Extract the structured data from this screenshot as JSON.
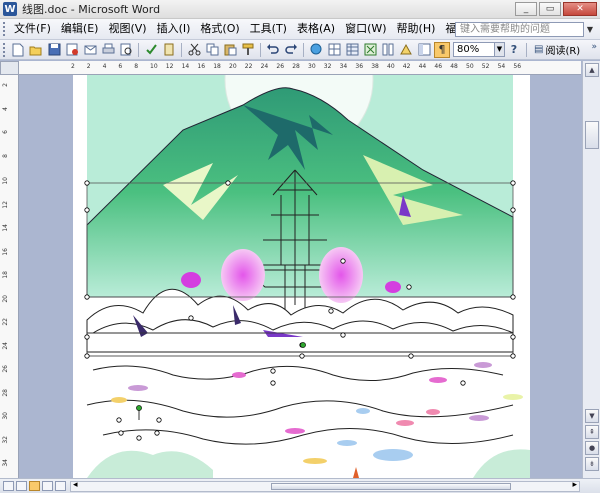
{
  "window": {
    "title": "线图.doc - Microsoft Word",
    "app_icon": "W",
    "minimize": "_",
    "restore": "▭",
    "close": "✕"
  },
  "menubar": {
    "items": [
      "文件(F)",
      "编辑(E)",
      "视图(V)",
      "插入(I)",
      "格式(O)",
      "工具(T)",
      "表格(A)",
      "窗口(W)",
      "帮助(H)",
      "福昕阅读器"
    ],
    "help_placeholder": "键入需要帮助的问题",
    "dropdown_glyph": "▼"
  },
  "toolbar": {
    "icons": [
      "new-document-icon",
      "open-folder-icon",
      "save-icon",
      "permission-icon",
      "email-icon",
      "print-icon",
      "print-preview-icon",
      "spelling-icon",
      "research-icon",
      "cut-icon",
      "copy-icon",
      "paste-icon",
      "format-painter-icon",
      "undo-icon",
      "redo-icon",
      "hyperlink-icon",
      "tables-borders-icon",
      "insert-table-icon",
      "insert-excel-icon",
      "columns-icon",
      "drawing-icon",
      "document-map-icon",
      "show-hide-icon"
    ],
    "zoom_value": "80%",
    "help_glyph": "?",
    "read_label": "阅读(R)",
    "overflow_glyph": "»"
  },
  "ruler": {
    "h_labels": [
      "2",
      "2",
      "4",
      "6",
      "8",
      "10",
      "12",
      "14",
      "16",
      "18",
      "20",
      "22",
      "24",
      "26",
      "28",
      "30",
      "32",
      "34",
      "36",
      "38",
      "40",
      "42",
      "44",
      "46",
      "48",
      "50",
      "52",
      "54",
      "56"
    ],
    "v_labels": [
      "2",
      "4",
      "6",
      "8",
      "10",
      "12",
      "14",
      "16",
      "18",
      "20",
      "22",
      "24",
      "26",
      "28",
      "30",
      "32",
      "34"
    ]
  },
  "statusbar": {
    "scroll_left": "◂",
    "scroll_right": "▸"
  },
  "scrollbar": {
    "up": "▲",
    "down": "▼",
    "prev_page": "⇞",
    "select_browse": "●",
    "next_page": "⇟"
  },
  "colors": {
    "sky": "#b9ecd8",
    "mountain": "#3aaa7a",
    "mountain_light": "#c7eaa0",
    "magenta": "#d43ee0",
    "purple": "#7a38c8",
    "selection_handle": "#000000",
    "rotate_handle": "#2ea52e"
  }
}
